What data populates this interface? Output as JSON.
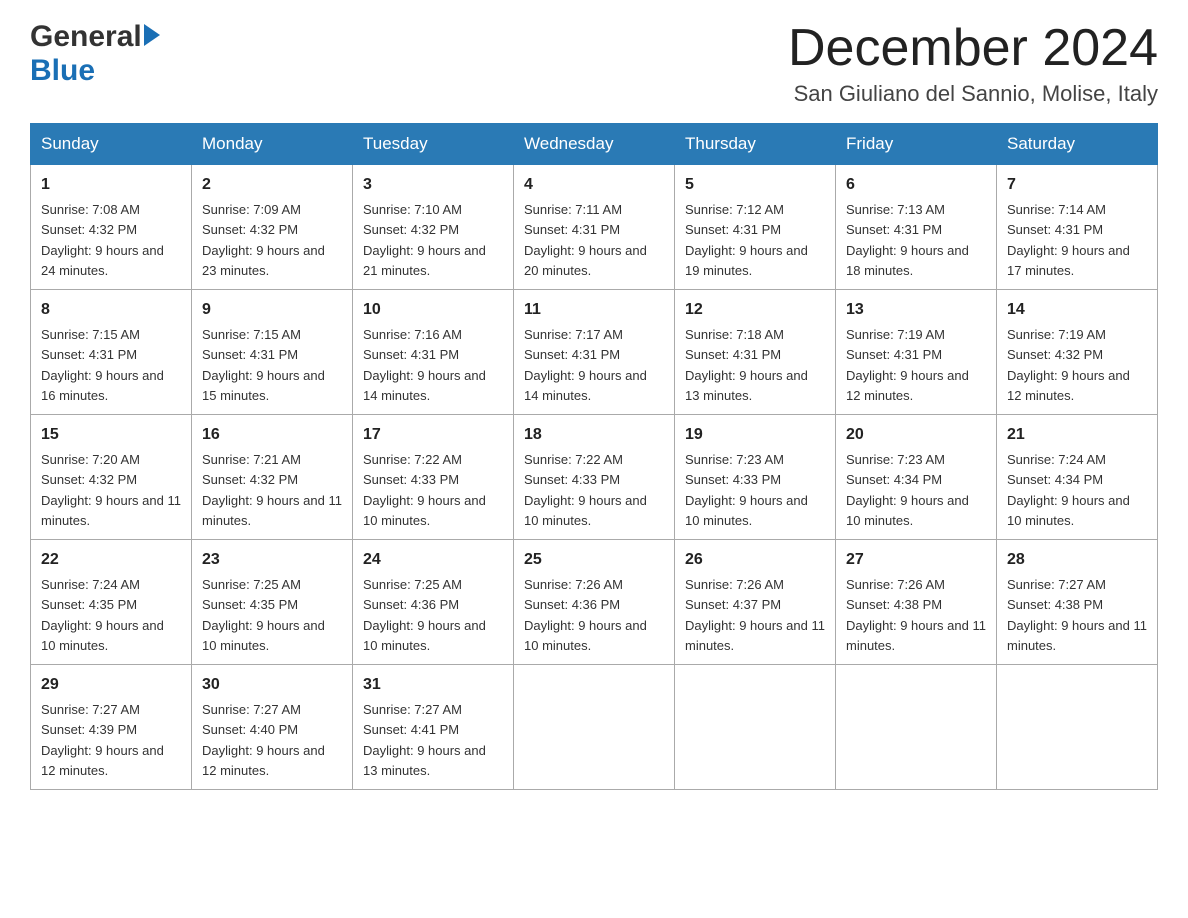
{
  "header": {
    "logo_general": "General",
    "logo_blue": "Blue",
    "title": "December 2024",
    "subtitle": "San Giuliano del Sannio, Molise, Italy"
  },
  "days_of_week": [
    "Sunday",
    "Monday",
    "Tuesday",
    "Wednesday",
    "Thursday",
    "Friday",
    "Saturday"
  ],
  "weeks": [
    [
      {
        "day": "1",
        "sunrise": "7:08 AM",
        "sunset": "4:32 PM",
        "daylight": "9 hours and 24 minutes."
      },
      {
        "day": "2",
        "sunrise": "7:09 AM",
        "sunset": "4:32 PM",
        "daylight": "9 hours and 23 minutes."
      },
      {
        "day": "3",
        "sunrise": "7:10 AM",
        "sunset": "4:32 PM",
        "daylight": "9 hours and 21 minutes."
      },
      {
        "day": "4",
        "sunrise": "7:11 AM",
        "sunset": "4:31 PM",
        "daylight": "9 hours and 20 minutes."
      },
      {
        "day": "5",
        "sunrise": "7:12 AM",
        "sunset": "4:31 PM",
        "daylight": "9 hours and 19 minutes."
      },
      {
        "day": "6",
        "sunrise": "7:13 AM",
        "sunset": "4:31 PM",
        "daylight": "9 hours and 18 minutes."
      },
      {
        "day": "7",
        "sunrise": "7:14 AM",
        "sunset": "4:31 PM",
        "daylight": "9 hours and 17 minutes."
      }
    ],
    [
      {
        "day": "8",
        "sunrise": "7:15 AM",
        "sunset": "4:31 PM",
        "daylight": "9 hours and 16 minutes."
      },
      {
        "day": "9",
        "sunrise": "7:15 AM",
        "sunset": "4:31 PM",
        "daylight": "9 hours and 15 minutes."
      },
      {
        "day": "10",
        "sunrise": "7:16 AM",
        "sunset": "4:31 PM",
        "daylight": "9 hours and 14 minutes."
      },
      {
        "day": "11",
        "sunrise": "7:17 AM",
        "sunset": "4:31 PM",
        "daylight": "9 hours and 14 minutes."
      },
      {
        "day": "12",
        "sunrise": "7:18 AM",
        "sunset": "4:31 PM",
        "daylight": "9 hours and 13 minutes."
      },
      {
        "day": "13",
        "sunrise": "7:19 AM",
        "sunset": "4:31 PM",
        "daylight": "9 hours and 12 minutes."
      },
      {
        "day": "14",
        "sunrise": "7:19 AM",
        "sunset": "4:32 PM",
        "daylight": "9 hours and 12 minutes."
      }
    ],
    [
      {
        "day": "15",
        "sunrise": "7:20 AM",
        "sunset": "4:32 PM",
        "daylight": "9 hours and 11 minutes."
      },
      {
        "day": "16",
        "sunrise": "7:21 AM",
        "sunset": "4:32 PM",
        "daylight": "9 hours and 11 minutes."
      },
      {
        "day": "17",
        "sunrise": "7:22 AM",
        "sunset": "4:33 PM",
        "daylight": "9 hours and 10 minutes."
      },
      {
        "day": "18",
        "sunrise": "7:22 AM",
        "sunset": "4:33 PM",
        "daylight": "9 hours and 10 minutes."
      },
      {
        "day": "19",
        "sunrise": "7:23 AM",
        "sunset": "4:33 PM",
        "daylight": "9 hours and 10 minutes."
      },
      {
        "day": "20",
        "sunrise": "7:23 AM",
        "sunset": "4:34 PM",
        "daylight": "9 hours and 10 minutes."
      },
      {
        "day": "21",
        "sunrise": "7:24 AM",
        "sunset": "4:34 PM",
        "daylight": "9 hours and 10 minutes."
      }
    ],
    [
      {
        "day": "22",
        "sunrise": "7:24 AM",
        "sunset": "4:35 PM",
        "daylight": "9 hours and 10 minutes."
      },
      {
        "day": "23",
        "sunrise": "7:25 AM",
        "sunset": "4:35 PM",
        "daylight": "9 hours and 10 minutes."
      },
      {
        "day": "24",
        "sunrise": "7:25 AM",
        "sunset": "4:36 PM",
        "daylight": "9 hours and 10 minutes."
      },
      {
        "day": "25",
        "sunrise": "7:26 AM",
        "sunset": "4:36 PM",
        "daylight": "9 hours and 10 minutes."
      },
      {
        "day": "26",
        "sunrise": "7:26 AM",
        "sunset": "4:37 PM",
        "daylight": "9 hours and 11 minutes."
      },
      {
        "day": "27",
        "sunrise": "7:26 AM",
        "sunset": "4:38 PM",
        "daylight": "9 hours and 11 minutes."
      },
      {
        "day": "28",
        "sunrise": "7:27 AM",
        "sunset": "4:38 PM",
        "daylight": "9 hours and 11 minutes."
      }
    ],
    [
      {
        "day": "29",
        "sunrise": "7:27 AM",
        "sunset": "4:39 PM",
        "daylight": "9 hours and 12 minutes."
      },
      {
        "day": "30",
        "sunrise": "7:27 AM",
        "sunset": "4:40 PM",
        "daylight": "9 hours and 12 minutes."
      },
      {
        "day": "31",
        "sunrise": "7:27 AM",
        "sunset": "4:41 PM",
        "daylight": "9 hours and 13 minutes."
      },
      null,
      null,
      null,
      null
    ]
  ],
  "labels": {
    "sunrise": "Sunrise:",
    "sunset": "Sunset:",
    "daylight": "Daylight:"
  }
}
